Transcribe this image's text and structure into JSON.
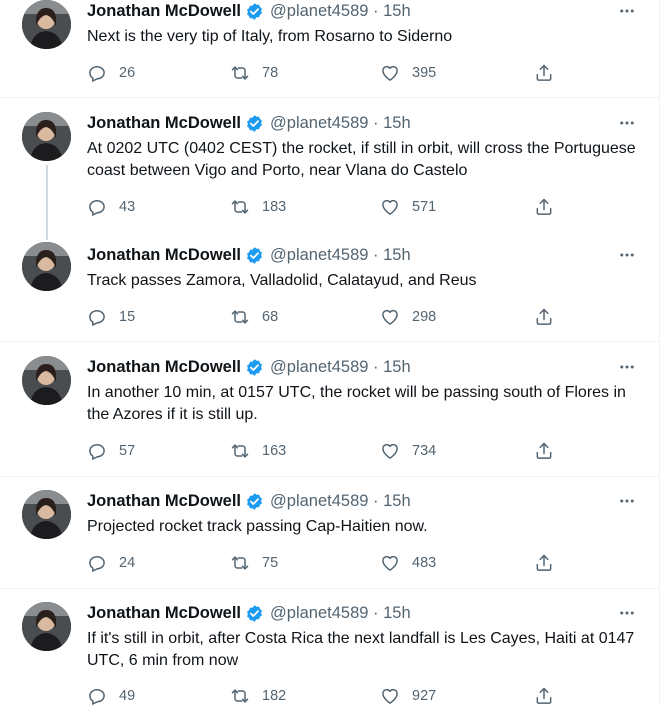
{
  "tweets": [
    {
      "name": "Jonathan McDowell",
      "handle": "@planet4589 · 15h",
      "text": "Next is the very tip of Italy, from Rosarno to Siderno",
      "replies": "26",
      "retweets": "78",
      "likes": "395"
    },
    {
      "name": "Jonathan McDowell",
      "handle": "@planet4589 · 15h",
      "text": "At 0202 UTC (0402 CEST) the rocket, if still in orbit, will cross the Portuguese coast between Vigo and Porto, near Vlana do Castelo",
      "replies": "43",
      "retweets": "183",
      "likes": "571"
    },
    {
      "name": "Jonathan McDowell",
      "handle": "@planet4589 · 15h",
      "text": "Track passes Zamora, Valladolid, Calatayud, and Reus",
      "replies": "15",
      "retweets": "68",
      "likes": "298"
    },
    {
      "name": "Jonathan McDowell",
      "handle": "@planet4589 · 15h",
      "text": "In another 10 min, at 0157 UTC, the rocket will be passing south of Flores in the Azores if it is still up.",
      "replies": "57",
      "retweets": "163",
      "likes": "734"
    },
    {
      "name": "Jonathan McDowell",
      "handle": "@planet4589 · 15h",
      "text": "Projected rocket track passing Cap-Haitien now.",
      "replies": "24",
      "retweets": "75",
      "likes": "483"
    },
    {
      "name": "Jonathan McDowell",
      "handle": "@planet4589 · 15h",
      "text": "If it's still in orbit, after Costa Rica the next landfall is Les Cayes, Haiti at 0147 UTC, 6 min from now",
      "replies": "49",
      "retweets": "182",
      "likes": "927"
    }
  ],
  "colors": {
    "text": "#0f1419",
    "muted": "#536471",
    "verified": "#1d9bf0",
    "divider": "#eff3f4",
    "thread": "#cfd9de"
  },
  "icons": {
    "reply": "reply-icon",
    "retweet": "retweet-icon",
    "like": "like-icon",
    "share": "share-icon",
    "more": "more-icon",
    "verified": "verified-badge-icon"
  }
}
